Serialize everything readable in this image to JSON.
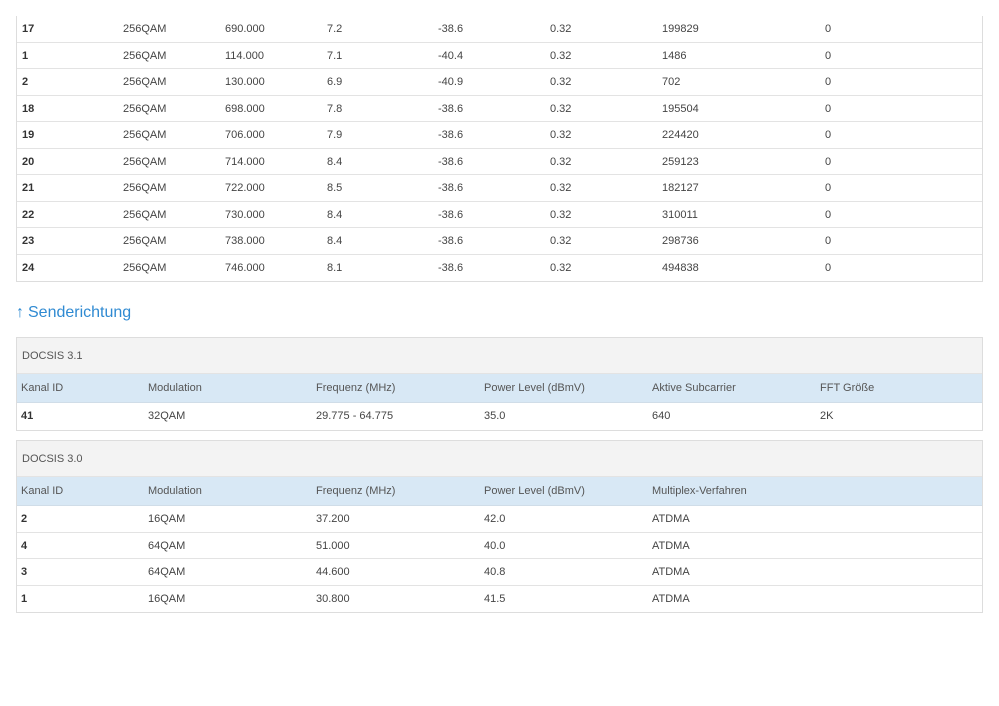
{
  "downstream_rows": [
    [
      "17",
      "256QAM",
      "690.000",
      "7.2",
      "-38.6",
      "0.32",
      "199829",
      "0"
    ],
    [
      "1",
      "256QAM",
      "114.000",
      "7.1",
      "-40.4",
      "0.32",
      "1486",
      "0"
    ],
    [
      "2",
      "256QAM",
      "130.000",
      "6.9",
      "-40.9",
      "0.32",
      "702",
      "0"
    ],
    [
      "18",
      "256QAM",
      "698.000",
      "7.8",
      "-38.6",
      "0.32",
      "195504",
      "0"
    ],
    [
      "19",
      "256QAM",
      "706.000",
      "7.9",
      "-38.6",
      "0.32",
      "224420",
      "0"
    ],
    [
      "20",
      "256QAM",
      "714.000",
      "8.4",
      "-38.6",
      "0.32",
      "259123",
      "0"
    ],
    [
      "21",
      "256QAM",
      "722.000",
      "8.5",
      "-38.6",
      "0.32",
      "182127",
      "0"
    ],
    [
      "22",
      "256QAM",
      "730.000",
      "8.4",
      "-38.6",
      "0.32",
      "310011",
      "0"
    ],
    [
      "23",
      "256QAM",
      "738.000",
      "8.4",
      "-38.6",
      "0.32",
      "298736",
      "0"
    ],
    [
      "24",
      "256QAM",
      "746.000",
      "8.1",
      "-38.6",
      "0.32",
      "494838",
      "0"
    ]
  ],
  "upstream": {
    "arrow": "↑",
    "title": "Senderichtung",
    "docsis31": {
      "title": "DOCSIS 3.1",
      "headers": [
        "Kanal ID",
        "Modulation",
        "Frequenz (MHz)",
        "Power Level (dBmV)",
        "Aktive Subcarrier",
        "FFT Größe"
      ],
      "rows": [
        [
          "41",
          "32QAM",
          "29.775 - 64.775",
          "35.0",
          "640",
          "2K"
        ]
      ]
    },
    "docsis30": {
      "title": "DOCSIS 3.0",
      "headers": [
        "Kanal ID",
        "Modulation",
        "Frequenz (MHz)",
        "Power Level (dBmV)",
        "Multiplex-Verfahren"
      ],
      "rows": [
        [
          "2",
          "16QAM",
          "37.200",
          "42.0",
          "ATDMA"
        ],
        [
          "4",
          "64QAM",
          "51.000",
          "40.0",
          "ATDMA"
        ],
        [
          "3",
          "64QAM",
          "44.600",
          "40.8",
          "ATDMA"
        ],
        [
          "1",
          "16QAM",
          "30.800",
          "41.5",
          "ATDMA"
        ]
      ]
    }
  }
}
